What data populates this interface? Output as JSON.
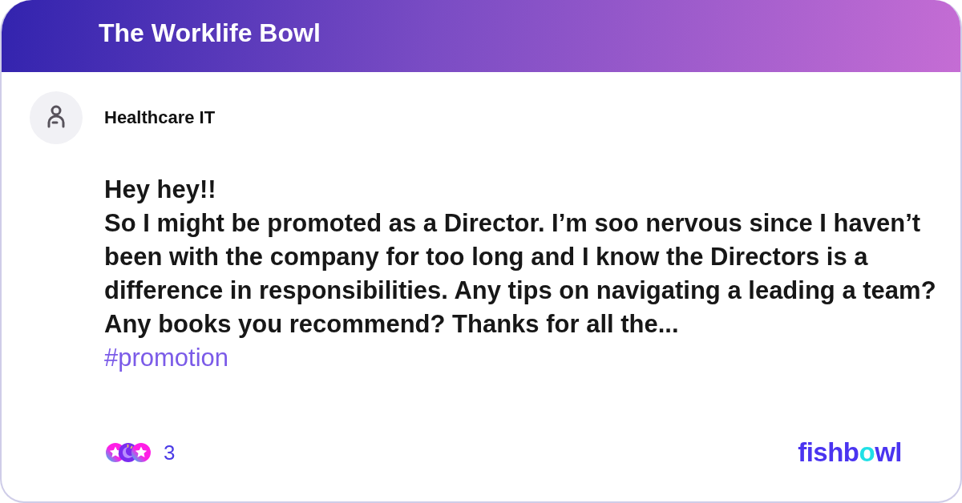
{
  "header": {
    "title": "The Worklife Bowl"
  },
  "post": {
    "author": "Healthcare IT",
    "lines": [
      "Hey hey!!",
      "So I might be promoted as a Director. I’m soo nervous since I haven’t been with the company for too long and I know the Directors is a difference in responsibilities. Any tips on navigating a leading a team? Any books you recommend? Thanks for all the..."
    ],
    "hashtag": "#promotion"
  },
  "footer": {
    "reaction_count": "3",
    "logo": [
      {
        "text": "fishb",
        "accent": false
      },
      {
        "text": "o",
        "accent": true
      },
      {
        "text": "wl",
        "accent": false
      }
    ]
  }
}
